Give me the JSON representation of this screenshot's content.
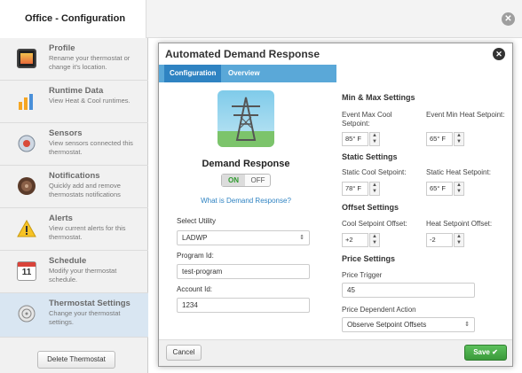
{
  "window": {
    "title": "Office - Configuration"
  },
  "sidebar": {
    "items": [
      {
        "title": "Profile",
        "desc": "Rename your thermostat or change it's location."
      },
      {
        "title": "Runtime Data",
        "desc": "View Heat & Cool runtimes."
      },
      {
        "title": "Sensors",
        "desc": "View sensors connected this thermostat."
      },
      {
        "title": "Notifications",
        "desc": "Quickly add and remove thermostats notifications"
      },
      {
        "title": "Alerts",
        "desc": "View current alerts for this thermostat."
      },
      {
        "title": "Schedule",
        "desc": "Modify your thermostat schedule.",
        "icon_text": "11"
      },
      {
        "title": "Thermostat Settings",
        "desc": "Change your thermostat settings."
      }
    ],
    "delete_label": "Delete Thermostat"
  },
  "modal": {
    "title": "Automated Demand Response",
    "tabs": [
      "Configuration",
      "Overview"
    ],
    "dr_title": "Demand Response",
    "toggle_on": "ON",
    "toggle_off": "OFF",
    "link": "What is Demand Response?",
    "utility_label": "Select Utility",
    "utility_value": "LADWP",
    "program_label": "Program Id:",
    "program_value": "test-program",
    "account_label": "Account Id:",
    "account_value": "1234",
    "minmax": {
      "title": "Min & Max Settings",
      "max_cool_label": "Event Max Cool Setpoint:",
      "max_cool_value": "85° F",
      "min_heat_label": "Event Min Heat Setpoint:",
      "min_heat_value": "65° F"
    },
    "static": {
      "title": "Static Settings",
      "cool_label": "Static Cool Setpoint:",
      "cool_value": "78° F",
      "heat_label": "Static Heat Setpoint:",
      "heat_value": "65° F"
    },
    "offset": {
      "title": "Offset Settings",
      "cool_label": "Cool Setpoint Offset:",
      "cool_value": "+2",
      "heat_label": "Heat Setpoint Offset:",
      "heat_value": "-2"
    },
    "price": {
      "title": "Price Settings",
      "trigger_label": "Price Trigger",
      "trigger_value": "45",
      "action_label": "Price Dependent Action",
      "action_value": "Observe Setpoint Offsets"
    },
    "cancel_label": "Cancel",
    "save_label": "Save ✔"
  },
  "colors": {
    "tab_bar": "#5aa8d8",
    "tab_active": "#2f83c2",
    "save_green": "#3b9a3b",
    "active_sidebar": "#d9e6f2"
  }
}
